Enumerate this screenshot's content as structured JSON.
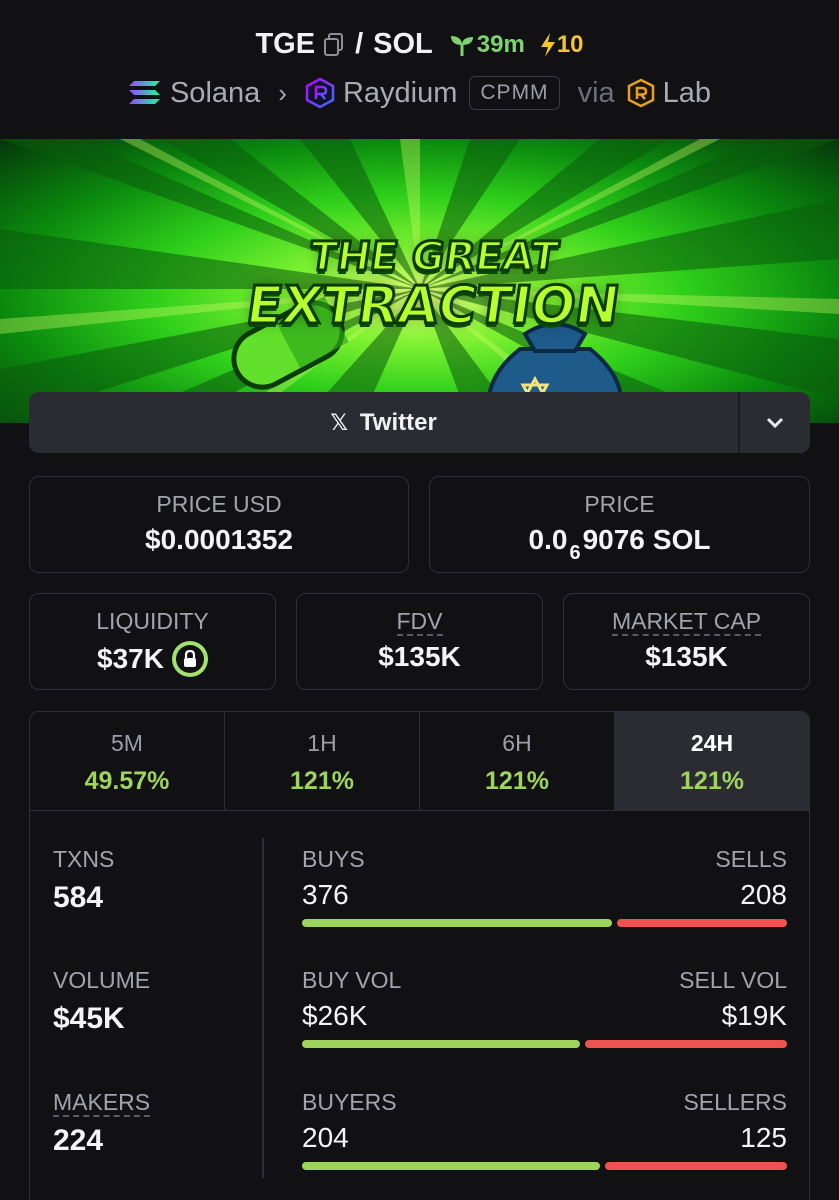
{
  "pair": {
    "base": "TGE",
    "separator": "/",
    "quote": "SOL",
    "age": "39m",
    "boosts": "10"
  },
  "breadcrumb": {
    "chain": "Solana",
    "dex": "Raydium",
    "pool_type": "CPMM",
    "via": "via",
    "launchpad": "Lab"
  },
  "banner": {
    "line1": "THE GREAT",
    "line2": "EXTRACTION"
  },
  "socials": {
    "twitter_label": "Twitter"
  },
  "prices": {
    "usd_label": "PRICE USD",
    "usd_value": "$0.0001352",
    "native_label": "PRICE",
    "native_prefix": "0.0",
    "native_zero_count": "6",
    "native_digits": "9076",
    "native_unit": "SOL"
  },
  "metrics": {
    "liquidity_label": "LIQUIDITY",
    "liquidity_value": "$37K",
    "fdv_label": "FDV",
    "fdv_value": "$135K",
    "mcap_label": "MARKET CAP",
    "mcap_value": "$135K"
  },
  "timeframes": [
    {
      "label": "5M",
      "change": "49.57%"
    },
    {
      "label": "1H",
      "change": "121%"
    },
    {
      "label": "6H",
      "change": "121%"
    },
    {
      "label": "24H",
      "change": "121%",
      "active": true
    }
  ],
  "txns": {
    "txns_label": "TXNS",
    "txns_value": "584",
    "volume_label": "VOLUME",
    "volume_value": "$45K",
    "makers_label": "MAKERS",
    "makers_value": "224",
    "buys_label": "BUYS",
    "buys_value": "376",
    "sells_label": "SELLS",
    "sells_value": "208",
    "buys_ratio": 0.644,
    "buyvol_label": "BUY VOL",
    "buyvol_value": "$26K",
    "sellvol_label": "SELL VOL",
    "sellvol_value": "$19K",
    "buyvol_ratio": 0.578,
    "buyers_label": "BUYERS",
    "buyers_value": "204",
    "sellers_label": "SELLERS",
    "sellers_value": "125",
    "buyers_ratio": 0.62
  },
  "colors": {
    "positive": "#9ed45b",
    "negative": "#ef5350",
    "boost": "#f4c531",
    "age": "#7cd36f"
  }
}
